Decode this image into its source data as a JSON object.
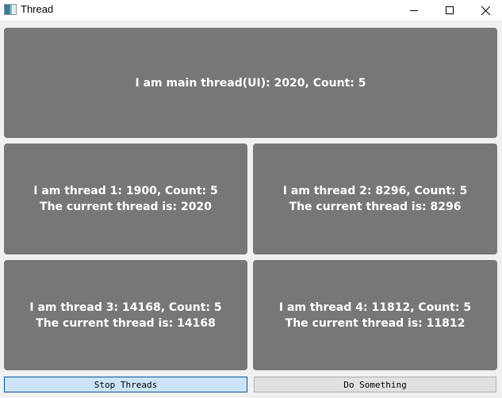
{
  "window": {
    "title": "Thread"
  },
  "main_panel": {
    "line1": "I am main thread(UI): 2020, Count: 5"
  },
  "threads": [
    {
      "line1": "I am thread 1: 1900, Count: 5",
      "line2": "The current thread is: 2020"
    },
    {
      "line1": "I am thread 2: 8296, Count: 5",
      "line2": "The current thread is: 8296"
    },
    {
      "line1": "I am thread 3: 14168, Count: 5",
      "line2": "The current thread is: 14168"
    },
    {
      "line1": "I am thread 4: 11812, Count: 5",
      "line2": "The current thread is: 11812"
    }
  ],
  "buttons": {
    "stop": "Stop Threads",
    "do_something": "Do Something"
  },
  "colors": {
    "panel": "#777777",
    "primary_button": "#cce4f7",
    "primary_border": "#0055a4"
  }
}
